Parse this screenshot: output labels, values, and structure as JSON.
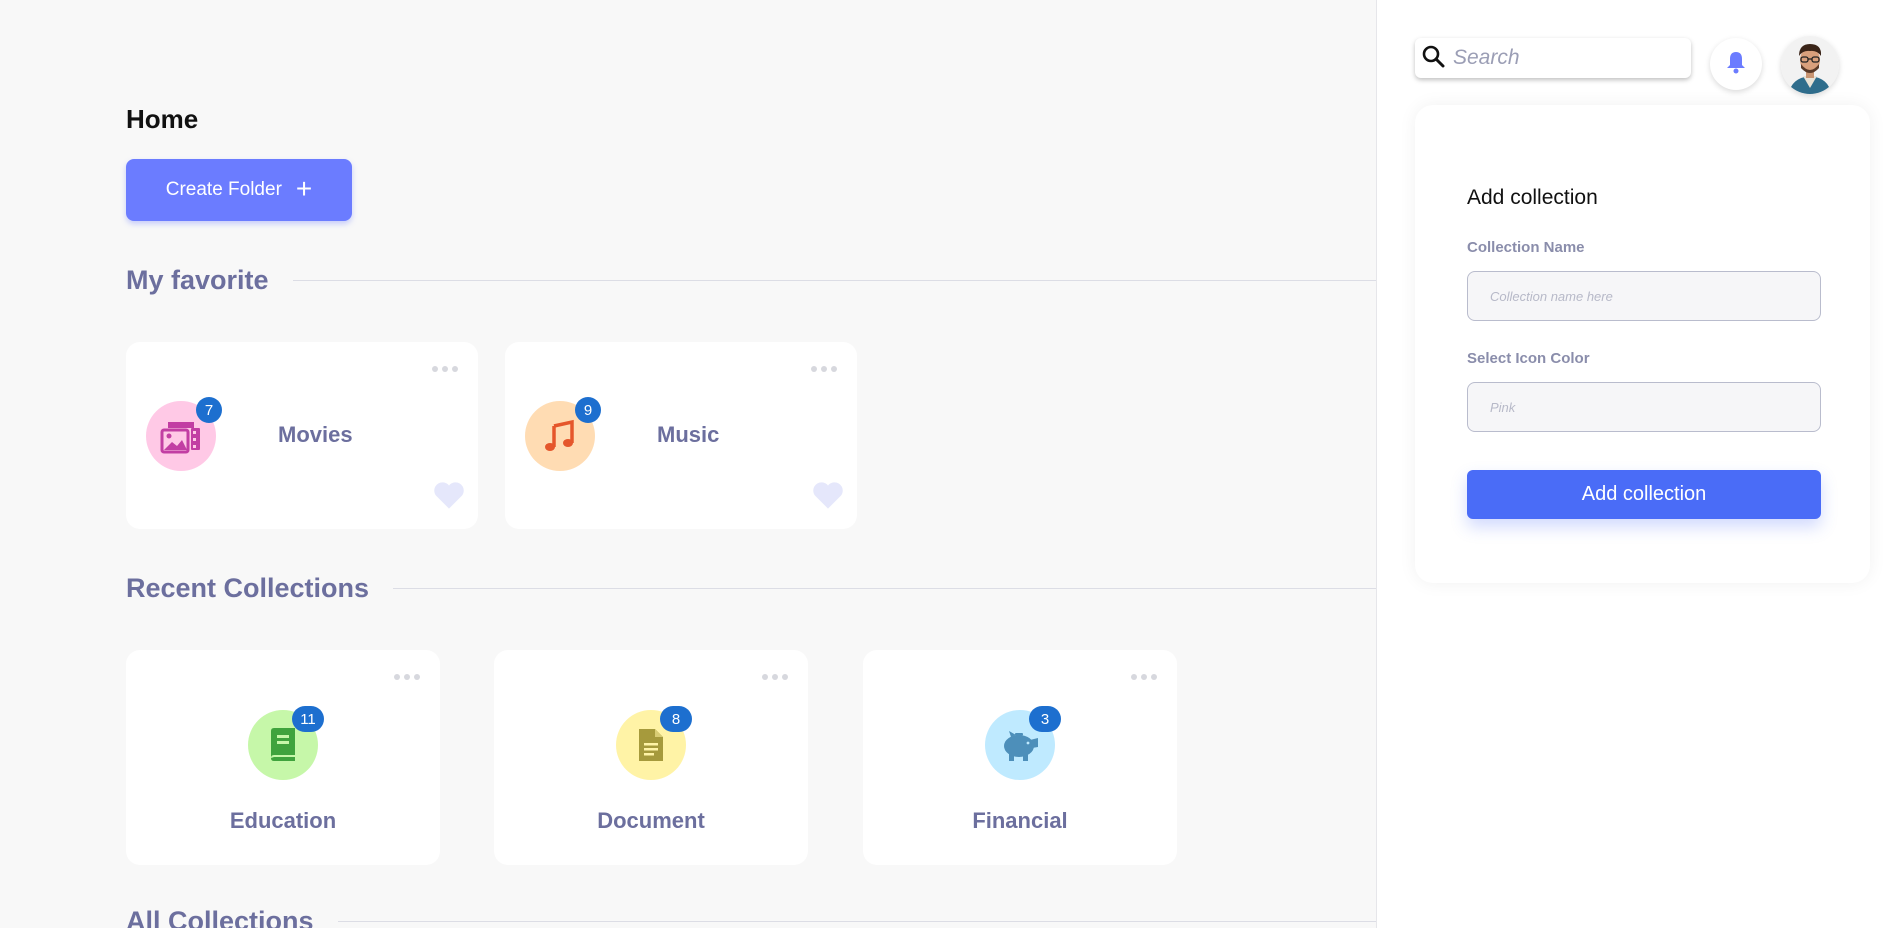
{
  "page": {
    "title": "Home"
  },
  "actions": {
    "create_folder_label": "Create Folder"
  },
  "sections": {
    "favorite": "My favorite",
    "recent": "Recent Collections",
    "all": "All Collections"
  },
  "favorites": [
    {
      "name": "Movies",
      "count": "7",
      "icon": "photo-gallery-icon",
      "bg": "#ffc9e6",
      "color": "#c23ea3"
    },
    {
      "name": "Music",
      "count": "9",
      "icon": "music-note-icon",
      "bg": "#ffdcb3",
      "color": "#e5562b"
    }
  ],
  "recent": [
    {
      "name": "Education",
      "count": "11",
      "icon": "book-icon",
      "bg": "#c6f7a9",
      "color": "#3fa33d"
    },
    {
      "name": "Document",
      "count": "8",
      "icon": "document-icon",
      "bg": "#fff3a6",
      "color": "#a69a3c"
    },
    {
      "name": "Financial",
      "count": "3",
      "icon": "piggy-bank-icon",
      "bg": "#bfeaff",
      "color": "#4d8fba"
    }
  ],
  "header": {
    "search_placeholder": "Search"
  },
  "add_collection": {
    "title": "Add collection",
    "name_label": "Collection Name",
    "name_placeholder": "Collection name here",
    "color_label": "Select Icon Color",
    "color_placeholder": "Pink",
    "submit_label": "Add collection"
  },
  "colors": {
    "accent": "#6b7cff",
    "primary_button": "#4a6cf7",
    "badge": "#1d6fcf",
    "section_text": "#6c6f9e"
  }
}
